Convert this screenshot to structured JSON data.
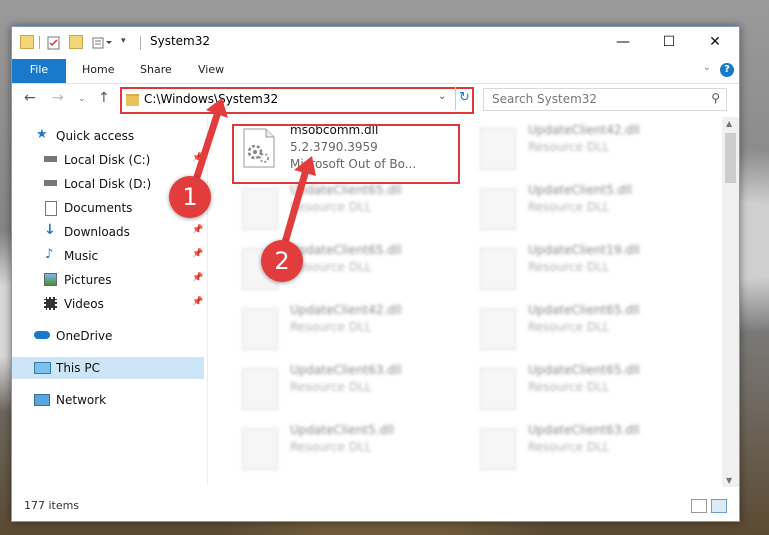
{
  "window": {
    "title": "System32",
    "controls": {
      "minimize": "—",
      "maximize": "☐",
      "close": "✕"
    }
  },
  "ribbon": {
    "tabs": [
      "File",
      "Home",
      "Share",
      "View"
    ],
    "help_label": "?"
  },
  "nav": {
    "address": "C:\\Windows\\System32",
    "search_placeholder": "Search System32"
  },
  "sidebar": {
    "items": [
      {
        "label": "Quick access",
        "icon": "star-icon",
        "pinned": false
      },
      {
        "label": "Local Disk (C:)",
        "icon": "drive-icon",
        "pinned": true
      },
      {
        "label": "Local Disk (D:)",
        "icon": "drive-icon",
        "pinned": false
      },
      {
        "label": "Documents",
        "icon": "documents-icon",
        "pinned": true
      },
      {
        "label": "Downloads",
        "icon": "download-icon",
        "pinned": true
      },
      {
        "label": "Music",
        "icon": "music-icon",
        "pinned": true
      },
      {
        "label": "Pictures",
        "icon": "pictures-icon",
        "pinned": true
      },
      {
        "label": "Videos",
        "icon": "videos-icon",
        "pinned": true
      },
      {
        "label": "OneDrive",
        "icon": "cloud-icon",
        "pinned": false
      },
      {
        "label": "This PC",
        "icon": "computer-icon",
        "pinned": false,
        "selected": true
      },
      {
        "label": "Network",
        "icon": "network-icon",
        "pinned": false
      }
    ]
  },
  "files": [
    {
      "name": "msobcomm.dll",
      "line1": "5.2.3790.3959",
      "line2": "Microsoft Out of Bo...",
      "highlighted": true
    },
    {
      "name": "UpdateClient42.dll",
      "line1": "Resource DLL"
    },
    {
      "name": "UpdateClient65.dll",
      "line1": "Resource DLL"
    },
    {
      "name": "UpdateClient5.dll",
      "line1": "Resource DLL"
    },
    {
      "name": "UpdateClient65.dll",
      "line1": "Resource DLL"
    },
    {
      "name": "UpdateClient19.dll",
      "line1": "Resource DLL"
    },
    {
      "name": "UpdateClient42.dll",
      "line1": "Resource DLL"
    },
    {
      "name": "UpdateClient65.dll",
      "line1": "Resource DLL"
    },
    {
      "name": "UpdateClient63.dll",
      "line1": "Resource DLL"
    },
    {
      "name": "UpdateClient65.dll",
      "line1": "Resource DLL"
    },
    {
      "name": "UpdateClient5.dll",
      "line1": "Resource DLL"
    },
    {
      "name": "UpdateClient63.dll",
      "line1": "Resource DLL"
    }
  ],
  "status": {
    "item_count": "177 items"
  },
  "callouts": [
    "1",
    "2"
  ],
  "colors": {
    "accent": "#1979ca",
    "callout": "#e23c3c",
    "selection": "#cde6f7"
  }
}
